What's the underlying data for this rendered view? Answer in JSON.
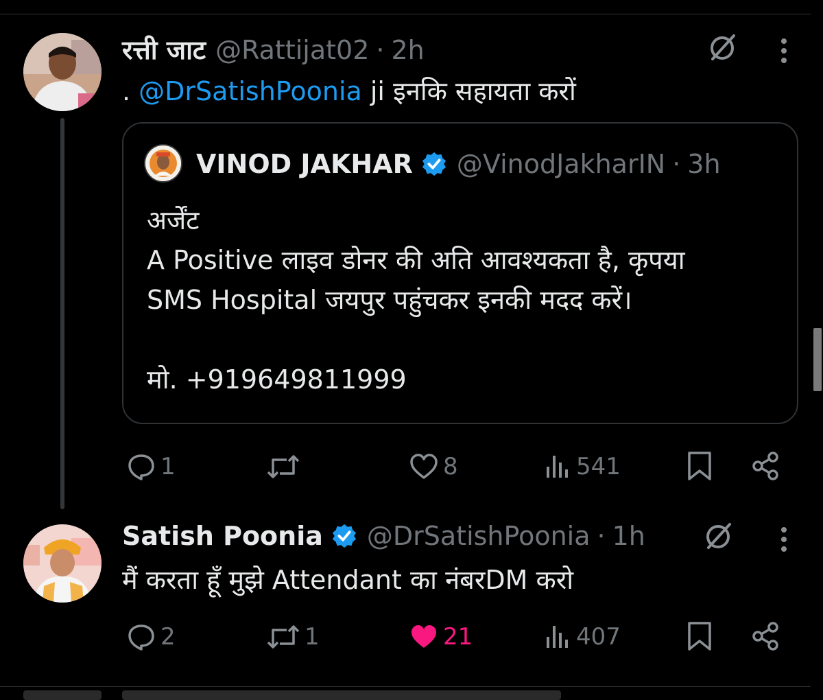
{
  "thread": [
    {
      "author": {
        "name": "रत्ती जाट",
        "handle": "@Rattijat02",
        "time": "2h",
        "verified": false
      },
      "text_prefix": ". ",
      "mention": "@DrSatishPoonia",
      "text_suffix": " ji इनकि सहायता करों",
      "quote": {
        "name": "VINOD JAKHAR",
        "handle": "@VinodJakharIN",
        "time": "3h",
        "verified": true,
        "lines": [
          "अर्जेंट",
          "A Positive लाइव डोनर की अति आवश्यकता है, कृपया",
          "SMS Hospital जयपुर पहुंचकर इनकी मदद करें।",
          "",
          "मो. +919649811999"
        ]
      },
      "actions": {
        "replies": "1",
        "reposts": "",
        "likes": "8",
        "views": "541",
        "liked": false
      }
    },
    {
      "author": {
        "name": "Satish Poonia",
        "handle": "@DrSatishPoonia",
        "time": "1h",
        "verified": true
      },
      "text": "मैं करता हूँ मुझे Attendant का नंबरDM करो",
      "actions": {
        "replies": "2",
        "reposts": "1",
        "likes": "21",
        "views": "407",
        "liked": true
      }
    }
  ],
  "dot_separator": "·",
  "colors": {
    "background": "#000000",
    "text": "#e7e9ea",
    "muted": "#71767b",
    "link": "#1d9bf0",
    "like": "#f91880",
    "verified": "#1d9bf0",
    "border": "#2f3336"
  }
}
